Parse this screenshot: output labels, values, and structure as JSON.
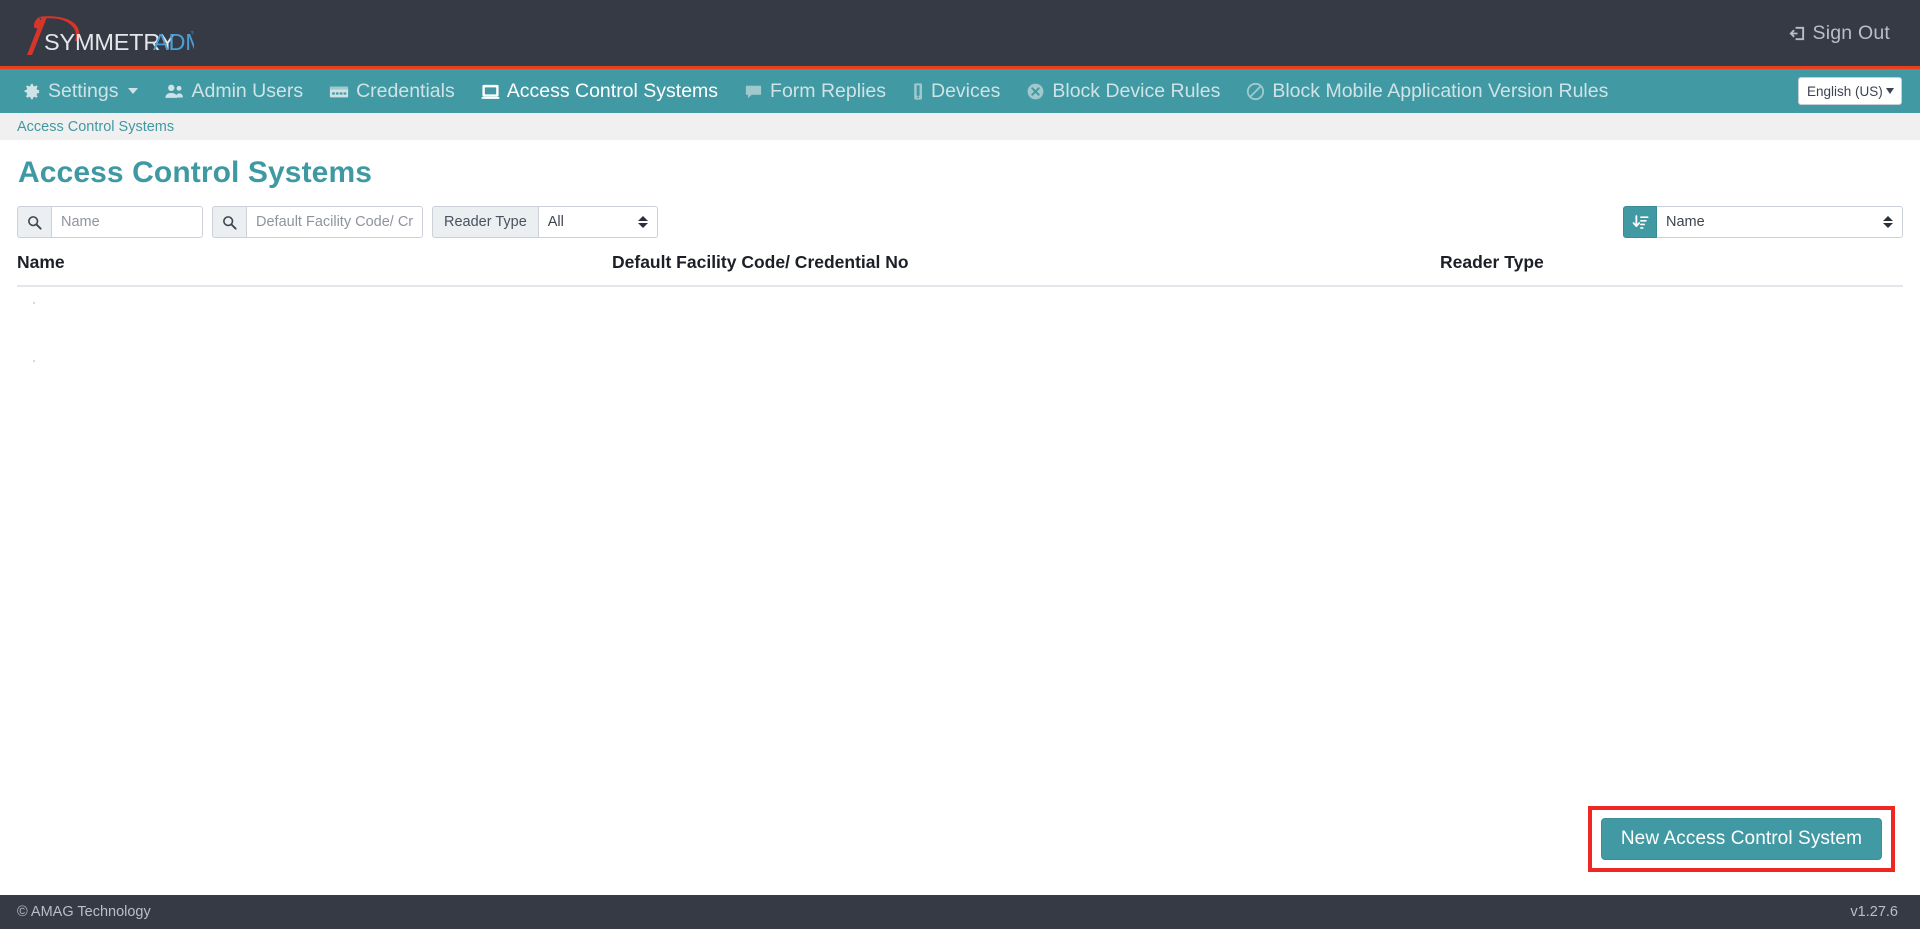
{
  "brand": {
    "name_primary": "SYMMETRY",
    "name_secondary": "ADMIN",
    "trademark": "™",
    "logo_icon": "eagle-head-logo",
    "color_primary": "#e3e6ea",
    "color_secondary": "#4a9fd4",
    "color_mark": "#d8352a"
  },
  "topbar": {
    "signout_label": "Sign Out",
    "signout_icon": "sign-out-icon",
    "background": "#353a45"
  },
  "nav": {
    "accent_line_color": "#e8401f",
    "background": "#4199a3",
    "items": [
      {
        "label": "Settings",
        "icon": "gear-icon",
        "active": false,
        "has_caret": true
      },
      {
        "label": "Admin Users",
        "icon": "users-icon",
        "active": false,
        "has_caret": false
      },
      {
        "label": "Credentials",
        "icon": "credential-card-icon",
        "active": false,
        "has_caret": false
      },
      {
        "label": "Access Control Systems",
        "icon": "access-control-panel-icon",
        "active": true,
        "has_caret": false
      },
      {
        "label": "Form Replies",
        "icon": "comment-icon",
        "active": false,
        "has_caret": false
      },
      {
        "label": "Devices",
        "icon": "mobile-device-icon",
        "active": false,
        "has_caret": false
      },
      {
        "label": "Block Device Rules",
        "icon": "times-circle-icon",
        "active": false,
        "has_caret": false
      },
      {
        "label": "Block Mobile Application Version Rules",
        "icon": "ban-icon",
        "active": false,
        "has_caret": false
      }
    ],
    "language": {
      "selected": "English (US)",
      "icon": "chevron-down-icon"
    }
  },
  "breadcrumb": {
    "items": [
      "Access Control Systems"
    ]
  },
  "page": {
    "title": "Access Control Systems"
  },
  "filters": {
    "name_search": {
      "icon": "search-icon",
      "value": "",
      "placeholder": "Name"
    },
    "facility_search": {
      "icon": "search-icon",
      "value": "",
      "placeholder": "Default Facility Code/ Credential No"
    },
    "reader_type": {
      "label": "Reader Type",
      "selected": "All",
      "icon": "updown-spinner-icon"
    },
    "sort": {
      "icon": "sort-amount-down-icon",
      "selected": "Name"
    }
  },
  "table": {
    "columns": [
      "Name",
      "Default Facility Code/ Credential No",
      "Reader Type"
    ],
    "rows": []
  },
  "actions": {
    "new_button_label": "New Access Control System",
    "highlight_color": "#ee2722"
  },
  "footer": {
    "copyright": "© AMAG Technology",
    "version": "v1.27.6"
  }
}
